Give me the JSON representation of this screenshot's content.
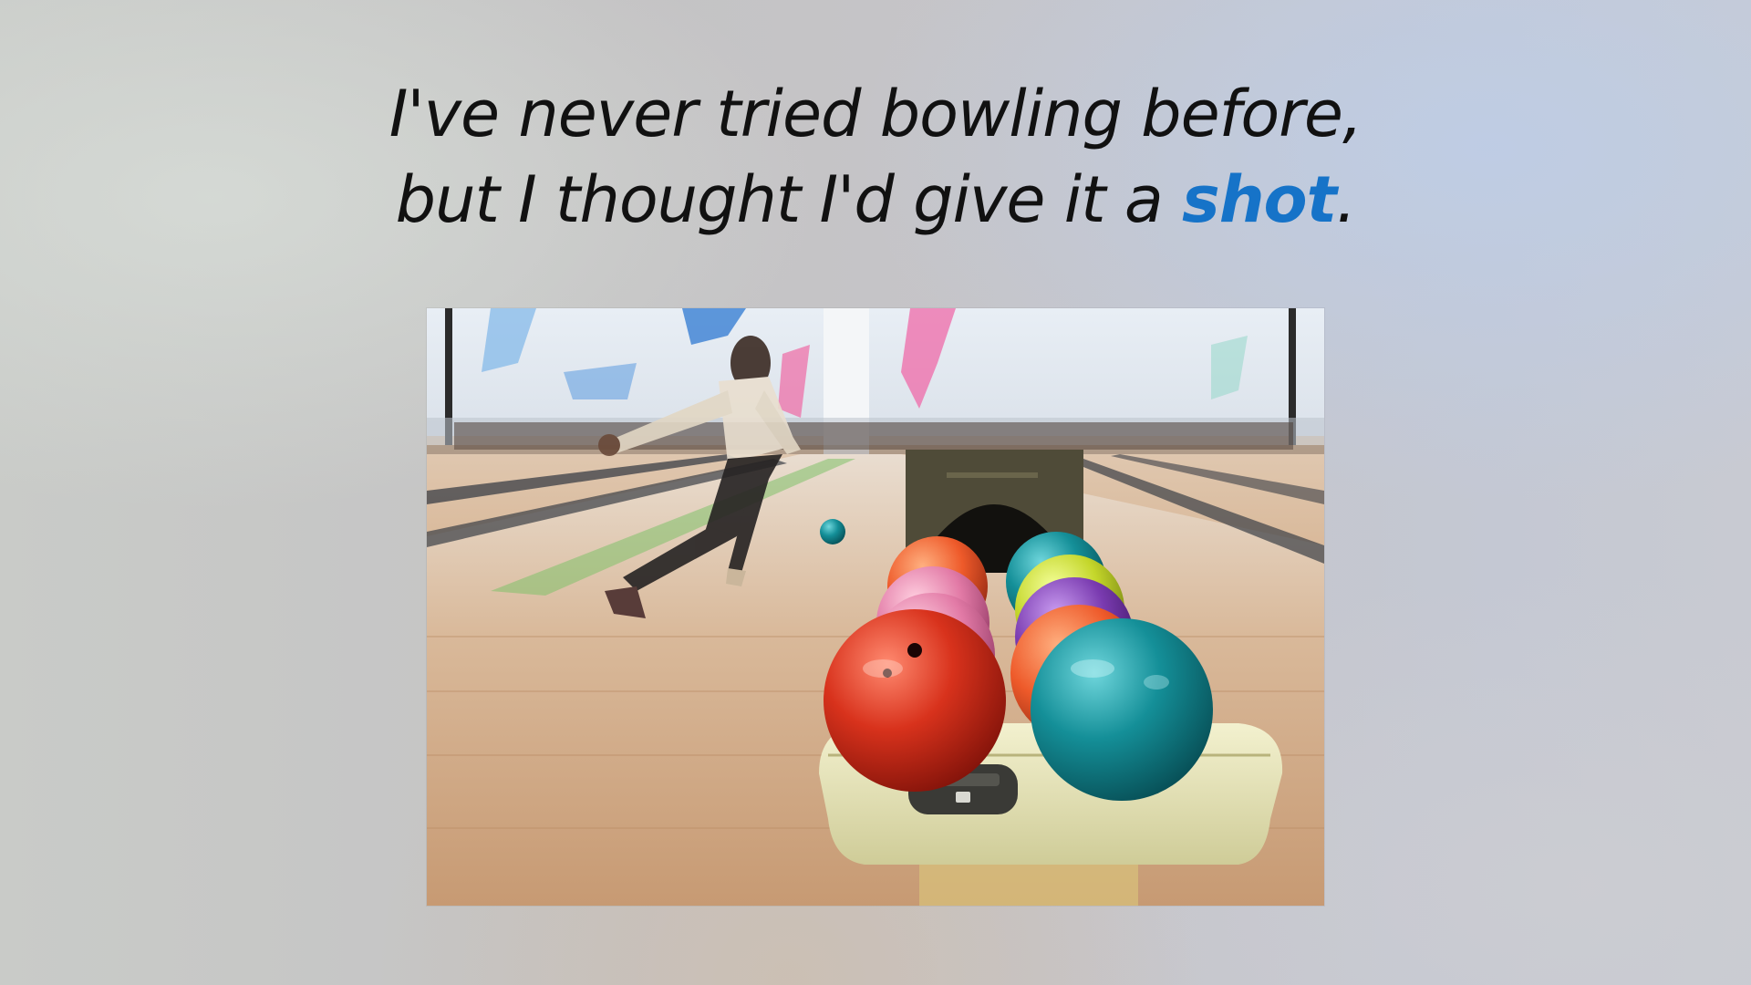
{
  "caption": {
    "line1": "I've never tried bowling before,",
    "line2_prefix": "but I thought I'd give it a ",
    "line2_emphasis": "shot",
    "line2_suffix": "."
  },
  "colors": {
    "caption_text": "#111111",
    "emphasis": "#1673c8"
  },
  "photo": {
    "subject": "bowling-ball-return-with-bowler"
  }
}
